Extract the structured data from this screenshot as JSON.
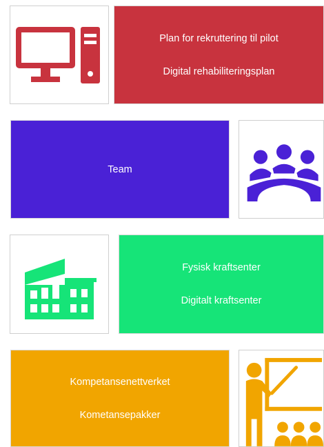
{
  "colors": {
    "red": "#c8333e",
    "indigo": "#4a21d6",
    "green": "#16e478",
    "amber": "#f1a500"
  },
  "rows": [
    {
      "icon": "desktop-computer-icon",
      "tile": {
        "lines": [
          "Plan for rekruttering til pilot",
          "Digital rehabiliteringsplan"
        ],
        "color": "#c8333e"
      }
    },
    {
      "icon": "team-meeting-icon",
      "tile": {
        "lines": [
          "Team"
        ],
        "color": "#4a21d6"
      }
    },
    {
      "icon": "building-icon",
      "tile": {
        "lines": [
          "Fysisk kraftsenter",
          "Digitalt kraftsenter"
        ],
        "color": "#16e478"
      }
    },
    {
      "icon": "teacher-presentation-icon",
      "tile": {
        "lines": [
          "Kompetansenettverket",
          "Kometansepakker"
        ],
        "color": "#f1a500"
      }
    }
  ]
}
